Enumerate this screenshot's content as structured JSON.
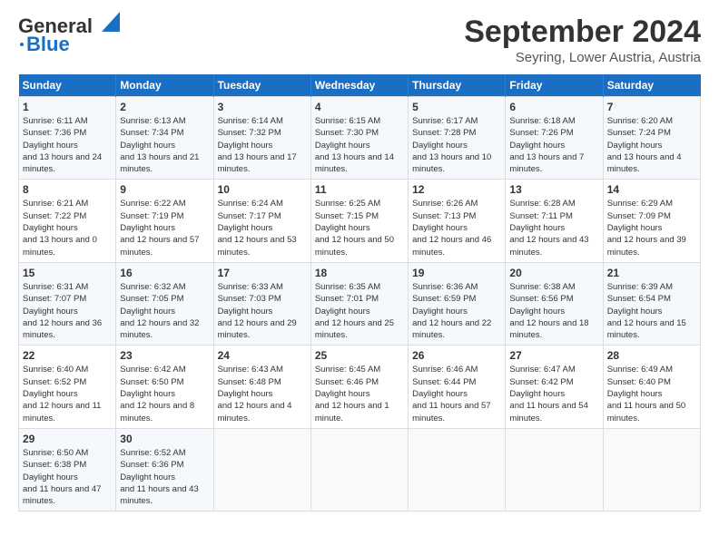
{
  "header": {
    "logo_line1": "General",
    "logo_line2": "Blue",
    "title": "September 2024",
    "subtitle": "Seyring, Lower Austria, Austria"
  },
  "days_of_week": [
    "Sunday",
    "Monday",
    "Tuesday",
    "Wednesday",
    "Thursday",
    "Friday",
    "Saturday"
  ],
  "weeks": [
    [
      {
        "day": "1",
        "sunrise": "6:11 AM",
        "sunset": "7:36 PM",
        "daylight": "13 hours and 24 minutes."
      },
      {
        "day": "2",
        "sunrise": "6:13 AM",
        "sunset": "7:34 PM",
        "daylight": "13 hours and 21 minutes."
      },
      {
        "day": "3",
        "sunrise": "6:14 AM",
        "sunset": "7:32 PM",
        "daylight": "13 hours and 17 minutes."
      },
      {
        "day": "4",
        "sunrise": "6:15 AM",
        "sunset": "7:30 PM",
        "daylight": "13 hours and 14 minutes."
      },
      {
        "day": "5",
        "sunrise": "6:17 AM",
        "sunset": "7:28 PM",
        "daylight": "13 hours and 10 minutes."
      },
      {
        "day": "6",
        "sunrise": "6:18 AM",
        "sunset": "7:26 PM",
        "daylight": "13 hours and 7 minutes."
      },
      {
        "day": "7",
        "sunrise": "6:20 AM",
        "sunset": "7:24 PM",
        "daylight": "13 hours and 4 minutes."
      }
    ],
    [
      {
        "day": "8",
        "sunrise": "6:21 AM",
        "sunset": "7:22 PM",
        "daylight": "13 hours and 0 minutes."
      },
      {
        "day": "9",
        "sunrise": "6:22 AM",
        "sunset": "7:19 PM",
        "daylight": "12 hours and 57 minutes."
      },
      {
        "day": "10",
        "sunrise": "6:24 AM",
        "sunset": "7:17 PM",
        "daylight": "12 hours and 53 minutes."
      },
      {
        "day": "11",
        "sunrise": "6:25 AM",
        "sunset": "7:15 PM",
        "daylight": "12 hours and 50 minutes."
      },
      {
        "day": "12",
        "sunrise": "6:26 AM",
        "sunset": "7:13 PM",
        "daylight": "12 hours and 46 minutes."
      },
      {
        "day": "13",
        "sunrise": "6:28 AM",
        "sunset": "7:11 PM",
        "daylight": "12 hours and 43 minutes."
      },
      {
        "day": "14",
        "sunrise": "6:29 AM",
        "sunset": "7:09 PM",
        "daylight": "12 hours and 39 minutes."
      }
    ],
    [
      {
        "day": "15",
        "sunrise": "6:31 AM",
        "sunset": "7:07 PM",
        "daylight": "12 hours and 36 minutes."
      },
      {
        "day": "16",
        "sunrise": "6:32 AM",
        "sunset": "7:05 PM",
        "daylight": "12 hours and 32 minutes."
      },
      {
        "day": "17",
        "sunrise": "6:33 AM",
        "sunset": "7:03 PM",
        "daylight": "12 hours and 29 minutes."
      },
      {
        "day": "18",
        "sunrise": "6:35 AM",
        "sunset": "7:01 PM",
        "daylight": "12 hours and 25 minutes."
      },
      {
        "day": "19",
        "sunrise": "6:36 AM",
        "sunset": "6:59 PM",
        "daylight": "12 hours and 22 minutes."
      },
      {
        "day": "20",
        "sunrise": "6:38 AM",
        "sunset": "6:56 PM",
        "daylight": "12 hours and 18 minutes."
      },
      {
        "day": "21",
        "sunrise": "6:39 AM",
        "sunset": "6:54 PM",
        "daylight": "12 hours and 15 minutes."
      }
    ],
    [
      {
        "day": "22",
        "sunrise": "6:40 AM",
        "sunset": "6:52 PM",
        "daylight": "12 hours and 11 minutes."
      },
      {
        "day": "23",
        "sunrise": "6:42 AM",
        "sunset": "6:50 PM",
        "daylight": "12 hours and 8 minutes."
      },
      {
        "day": "24",
        "sunrise": "6:43 AM",
        "sunset": "6:48 PM",
        "daylight": "12 hours and 4 minutes."
      },
      {
        "day": "25",
        "sunrise": "6:45 AM",
        "sunset": "6:46 PM",
        "daylight": "12 hours and 1 minute."
      },
      {
        "day": "26",
        "sunrise": "6:46 AM",
        "sunset": "6:44 PM",
        "daylight": "11 hours and 57 minutes."
      },
      {
        "day": "27",
        "sunrise": "6:47 AM",
        "sunset": "6:42 PM",
        "daylight": "11 hours and 54 minutes."
      },
      {
        "day": "28",
        "sunrise": "6:49 AM",
        "sunset": "6:40 PM",
        "daylight": "11 hours and 50 minutes."
      }
    ],
    [
      {
        "day": "29",
        "sunrise": "6:50 AM",
        "sunset": "6:38 PM",
        "daylight": "11 hours and 47 minutes."
      },
      {
        "day": "30",
        "sunrise": "6:52 AM",
        "sunset": "6:36 PM",
        "daylight": "11 hours and 43 minutes."
      },
      null,
      null,
      null,
      null,
      null
    ]
  ]
}
